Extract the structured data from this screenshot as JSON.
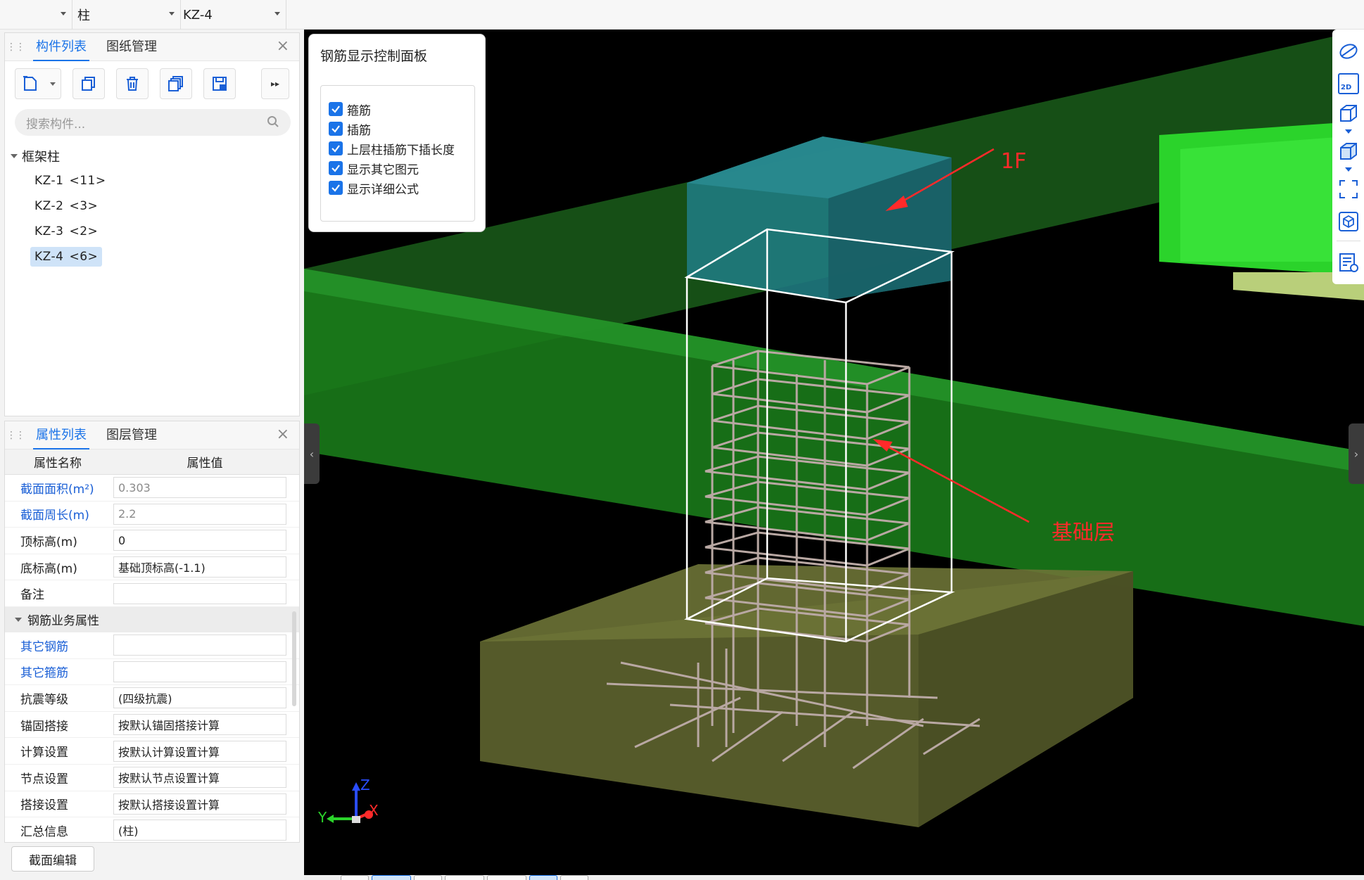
{
  "topbar": {
    "type_select": "柱",
    "component_select": "KZ-4"
  },
  "component_panel": {
    "tabs": [
      "构件列表",
      "图纸管理"
    ],
    "search_placeholder": "搜索构件...",
    "tree_root": "框架柱",
    "items": [
      {
        "name": "KZ-1",
        "count": "<11>"
      },
      {
        "name": "KZ-2",
        "count": "<3>"
      },
      {
        "name": "KZ-3",
        "count": "<2>"
      },
      {
        "name": "KZ-4",
        "count": "<6>"
      }
    ],
    "selected_index": 3
  },
  "property_panel": {
    "tabs": [
      "属性列表",
      "图层管理"
    ],
    "header": {
      "name": "属性名称",
      "value": "属性值"
    },
    "rows": [
      {
        "name": "截面面积(m²)",
        "value": "0.303",
        "blue": true,
        "gray": true
      },
      {
        "name": "截面周长(m)",
        "value": "2.2",
        "blue": true,
        "gray": true
      },
      {
        "name": "顶标高(m)",
        "value": "0"
      },
      {
        "name": "底标高(m)",
        "value": "基础顶标高(-1.1)"
      },
      {
        "name": "备注",
        "value": ""
      }
    ],
    "group_title": "钢筋业务属性",
    "group_rows": [
      {
        "name": "其它钢筋",
        "value": "",
        "blue": true
      },
      {
        "name": "其它箍筋",
        "value": "",
        "blue": true
      },
      {
        "name": "抗震等级",
        "value": "(四级抗震)"
      },
      {
        "name": "锚固搭接",
        "value": "按默认锚固搭接计算"
      },
      {
        "name": "计算设置",
        "value": "按默认计算设置计算"
      },
      {
        "name": "节点设置",
        "value": "按默认节点设置计算"
      },
      {
        "name": "搭接设置",
        "value": "按默认搭接设置计算"
      },
      {
        "name": "汇总信息",
        "value": "(柱)"
      }
    ],
    "bottom_button": "截面编辑"
  },
  "control_panel": {
    "title": "钢筋显示控制面板",
    "options": [
      {
        "label": "箍筋",
        "checked": true
      },
      {
        "label": "插筋",
        "checked": true
      },
      {
        "label": "上层柱插筋下插长度",
        "checked": true
      },
      {
        "label": "显示其它图元",
        "checked": true
      },
      {
        "label": "显示详细公式",
        "checked": true
      }
    ]
  },
  "annotations": {
    "top": "1F",
    "bottom": "基础层"
  },
  "axes": {
    "x": "X",
    "y": "Y",
    "z": "Z"
  },
  "right_toolbar": {
    "icons": [
      "orbit-icon",
      "2d-view-icon",
      "3d-box-icon",
      "solid-box-icon",
      "fit-view-icon",
      "cube-view-icon",
      "report-icon"
    ],
    "label_2d": "2D"
  },
  "colors": {
    "accent": "#1a73e8",
    "viewport_bg": "#000000",
    "beam_green": "#1f7a1f",
    "foundation_olive": "#5a5f2c",
    "column_top_teal": "#1f7a80",
    "annotation_red": "#ff2a2a"
  }
}
